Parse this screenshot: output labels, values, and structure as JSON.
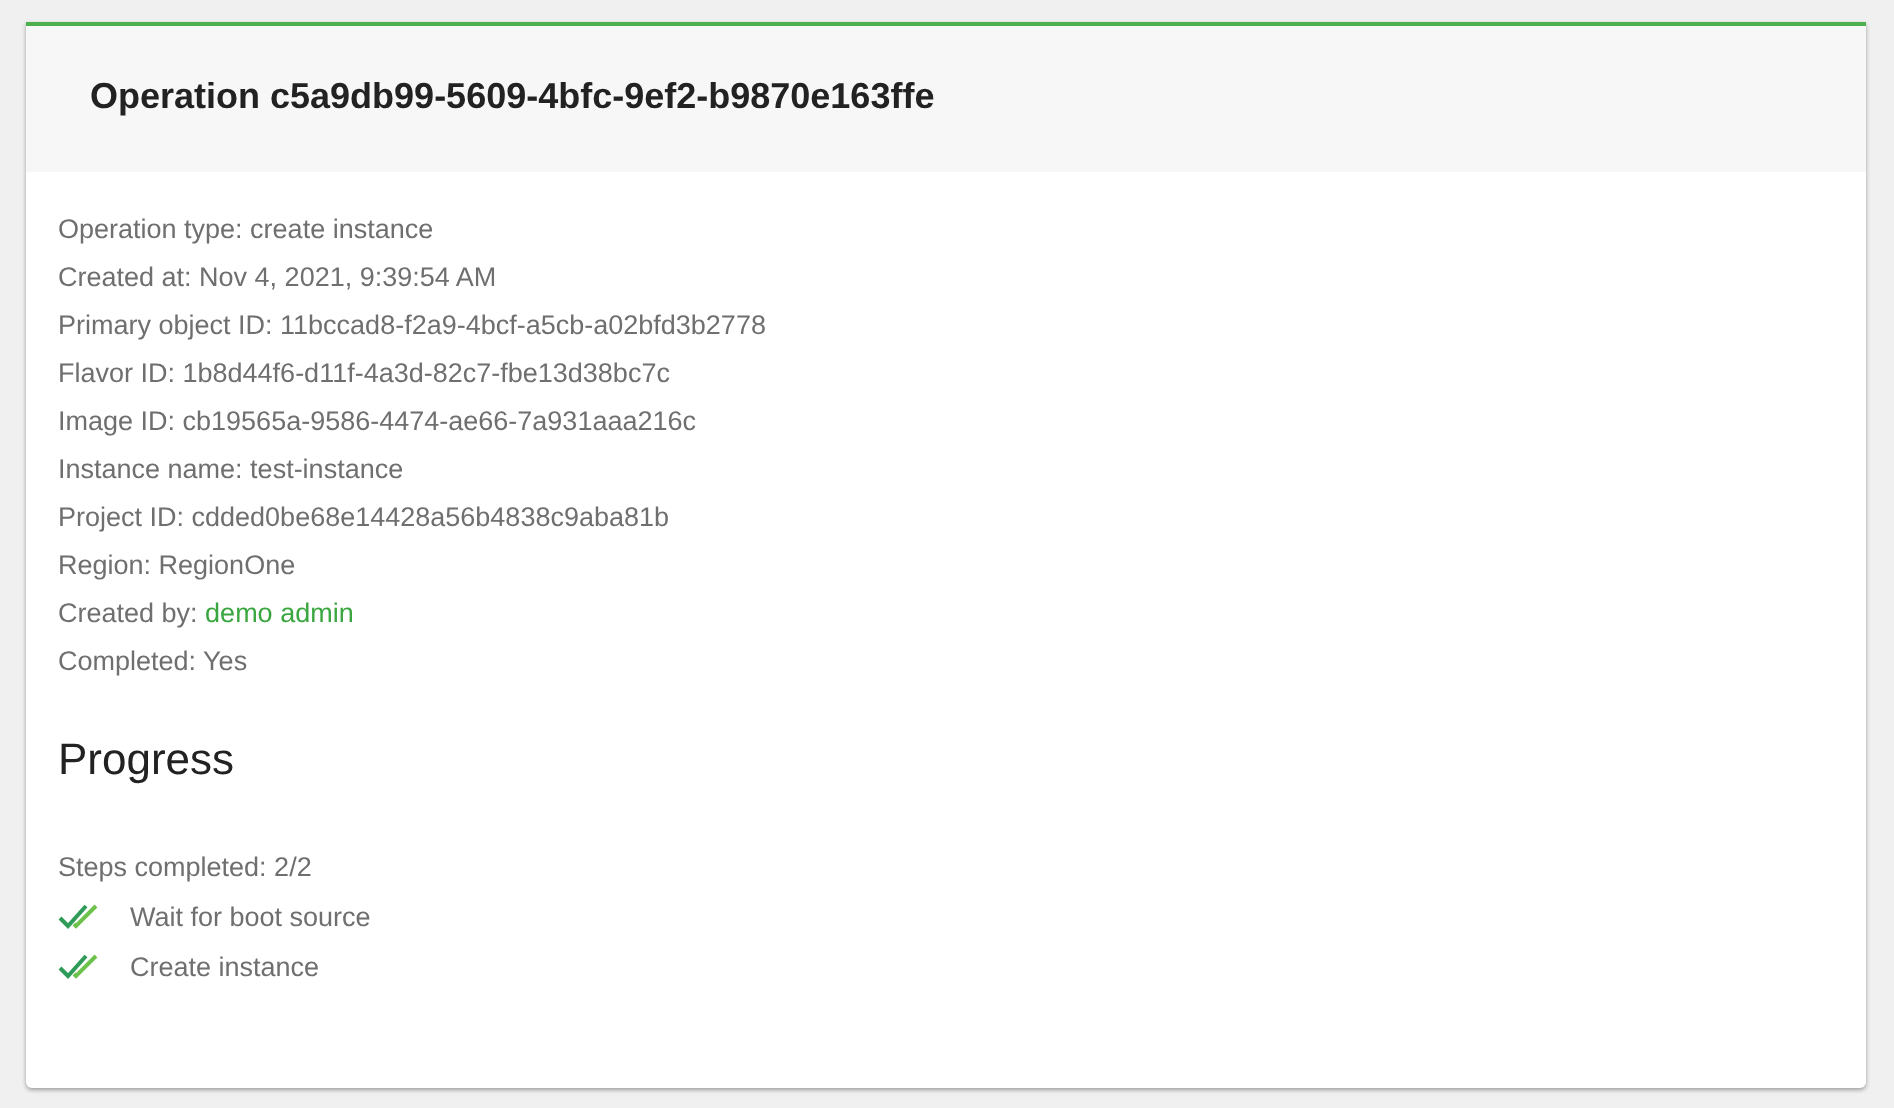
{
  "title": "Operation c5a9db99-5609-4bfc-9ef2-b9870e163ffe",
  "details": [
    {
      "label": "Operation type:",
      "value": "create instance",
      "kind": "text"
    },
    {
      "label": "Created at:",
      "value": "Nov 4, 2021, 9:39:54 AM",
      "kind": "text"
    },
    {
      "label": "Primary object ID:",
      "value": "11bccad8-f2a9-4bcf-a5cb-a02bfd3b2778",
      "kind": "text"
    },
    {
      "label": "Flavor ID:",
      "value": "1b8d44f6-d11f-4a3d-82c7-fbe13d38bc7c",
      "kind": "text"
    },
    {
      "label": "Image ID:",
      "value": "cb19565a-9586-4474-ae66-7a931aaa216c",
      "kind": "text"
    },
    {
      "label": "Instance name:",
      "value": "test-instance",
      "kind": "text"
    },
    {
      "label": "Project ID:",
      "value": "cdded0be68e14428a56b4838c9aba81b",
      "kind": "text"
    },
    {
      "label": "Region:",
      "value": "RegionOne",
      "kind": "text"
    },
    {
      "label": "Created by:",
      "value": "demo admin",
      "kind": "link"
    },
    {
      "label": "Completed:",
      "value": "Yes",
      "kind": "text"
    }
  ],
  "progress": {
    "heading": "Progress",
    "summary": "Steps completed: 2/2",
    "steps": [
      {
        "label": "Wait for boot source",
        "completed": true
      },
      {
        "label": "Create instance",
        "completed": true
      }
    ]
  }
}
